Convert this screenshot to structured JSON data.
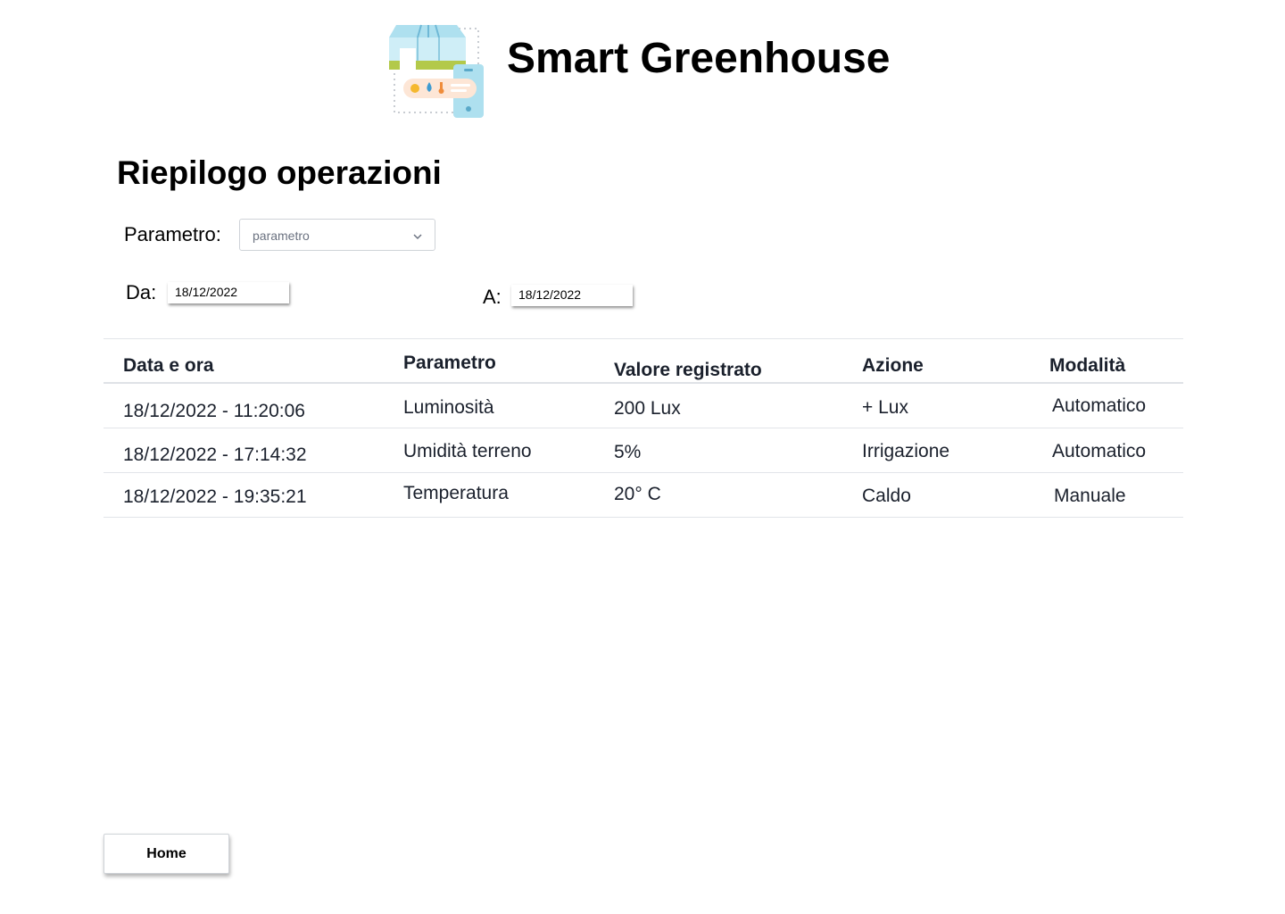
{
  "header": {
    "logo_icon": "greenhouse-icon",
    "title": "Smart Greenhouse"
  },
  "page": {
    "title": "Riepilogo operazioni"
  },
  "filters": {
    "parameter_label": "Parametro:",
    "parameter_select": {
      "value": "parametro",
      "icon": "chevron-down-icon"
    },
    "from_label": "Da:",
    "from_value": "18/12/2022",
    "to_label": "A:",
    "to_value": "18/12/2022"
  },
  "table": {
    "headers": [
      "Data e ora",
      "Parametro",
      "Valore registrato",
      "Azione",
      "Modalità"
    ],
    "rows": [
      [
        "18/12/2022 - 11:20:06",
        "Luminosità",
        "200 Lux",
        "+ Lux",
        "Automatico"
      ],
      [
        "18/12/2022 - 17:14:32",
        "Umidità terreno",
        "5%",
        "Irrigazione",
        "Automatico"
      ],
      [
        "18/12/2022 - 19:35:21",
        "Temperatura",
        "20° C",
        "Caldo",
        "Manuale"
      ]
    ]
  },
  "footer": {
    "home_label": "Home"
  },
  "colors": {
    "text_primary": "#1a202c",
    "divider": "#e2e5e9",
    "logo_glass": "#aee0ef",
    "logo_green": "#b3c94a",
    "logo_phone": "#aee0ef",
    "logo_sun": "#f5b82e",
    "logo_drop": "#3d9bd1",
    "logo_temp": "#ef8c3a"
  }
}
